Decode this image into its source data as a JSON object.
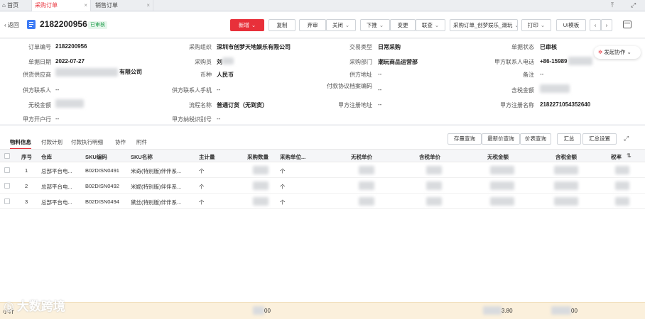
{
  "tabs": [
    {
      "label": "首页",
      "icon": "home-icon"
    },
    {
      "label": "采购订单"
    },
    {
      "label": "销售订单"
    }
  ],
  "header": {
    "back_label": "返回",
    "order_no": "2182200956",
    "status_badge": "已审核",
    "buttons": {
      "new": "新增",
      "copy": "复制",
      "abandon": "弃审",
      "close": "关闭",
      "push_down": "下推",
      "change": "变更",
      "query": "联查",
      "template_select": "采购订单_创梦娱乐_潮玩",
      "print": "打印",
      "ui_template": "UI模板"
    }
  },
  "collab_label": "发起协作",
  "fields": [
    {
      "label": "订单编号",
      "value": "2182200956"
    },
    {
      "label": "采购组织",
      "value": "深圳市创梦天地娱乐有限公司"
    },
    {
      "label": "交易类型",
      "value": "日常采购"
    },
    {
      "label": "单据状态",
      "value": "已审核"
    },
    {
      "label": "单据日期",
      "value": "2022-07-27"
    },
    {
      "label": "采购员",
      "value": "刘"
    },
    {
      "label": "采购部门",
      "value": "潮玩商品运营部"
    },
    {
      "label": "甲方联系人电话",
      "value": "+86-15989"
    },
    {
      "label": "供货供应商",
      "value": "有限公司"
    },
    {
      "label": "币种",
      "value": "人民币"
    },
    {
      "label": "供方地址",
      "value": "--"
    },
    {
      "label": "备注",
      "value": "--"
    },
    {
      "label": "供方联系人",
      "value": "--"
    },
    {
      "label": "供方联系人手机",
      "value": "--"
    },
    {
      "label": "付款协议档案编码",
      "value": "--"
    },
    {
      "label": "含税金额",
      "value": ""
    },
    {
      "label": "无税金额",
      "value": ""
    },
    {
      "label": "流程名称",
      "value": "普通订货（无到货）"
    },
    {
      "label": "甲方注册地址",
      "value": "--"
    },
    {
      "label": "甲方注册名称",
      "value": "2182271054352640"
    },
    {
      "label": "甲方开户行",
      "value": "--"
    },
    {
      "label": "甲方纳税识别号",
      "value": "--"
    }
  ],
  "sub_tabs": [
    "物料信息",
    "付款计划",
    "付款执行明细",
    "协作",
    "附件"
  ],
  "table_buttons": [
    "存量查询",
    "最新价查询",
    "价表查询",
    "汇总",
    "汇总设置"
  ],
  "columns": [
    "序号",
    "仓库",
    "SKU编码",
    "SKU名称",
    "主计量",
    "采购数量",
    "采购单位...",
    "无税单价",
    "含税单价",
    "无税金额",
    "含税金额",
    "税率"
  ],
  "rows": [
    {
      "seq": "1",
      "warehouse": "总部平台电...",
      "sku_code": "B02DISN0491",
      "sku_name": "米奇(特别版)伴伴系...",
      "unit": "个",
      "purchase_unit": "个"
    },
    {
      "seq": "2",
      "warehouse": "总部平台电...",
      "sku_code": "B02DISN0492",
      "sku_name": "米妮(特别版)伴伴系...",
      "unit": "个",
      "purchase_unit": "个"
    },
    {
      "seq": "3",
      "warehouse": "总部平台电...",
      "sku_code": "B02DISN0494",
      "sku_name": "黛丝(特别版)伴伴系...",
      "unit": "个",
      "purchase_unit": "个"
    }
  ],
  "footer": {
    "label": "小计",
    "qty_suffix": "00",
    "amount_suffix": "3.80",
    "tax_amount_suffix": "00"
  },
  "watermark": "大数跨境",
  "colors": {
    "accent": "#e8303a",
    "badge_bg": "#e7f6ec",
    "badge_text": "#1f9d4c",
    "footer_bg": "#fbf0dc"
  }
}
